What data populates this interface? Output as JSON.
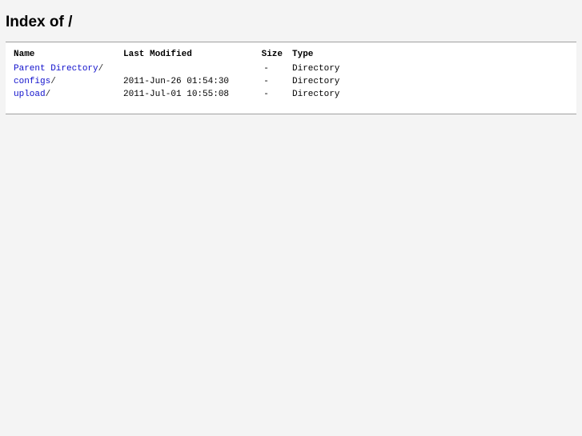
{
  "page": {
    "title": "Index of /"
  },
  "table": {
    "headers": {
      "name": "Name",
      "modified": "Last Modified",
      "size": "Size",
      "type": "Type"
    },
    "rows": [
      {
        "name": "Parent Directory",
        "suffix": "/",
        "modified": "",
        "size": "-",
        "type": "Directory"
      },
      {
        "name": "configs",
        "suffix": "/",
        "modified": "2011-Jun-26 01:54:30",
        "size": "-",
        "type": "Directory"
      },
      {
        "name": "upload",
        "suffix": "/",
        "modified": "2011-Jul-01 10:55:08",
        "size": "-",
        "type": "Directory"
      }
    ]
  },
  "colors": {
    "link": "#1010cc",
    "background": "#f4f4f4",
    "panel": "#ffffff"
  }
}
